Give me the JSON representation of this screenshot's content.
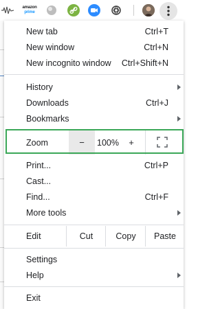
{
  "toolbar": {
    "amazon_line1": "amazon",
    "amazon_line2": "prime"
  },
  "menu": {
    "new_tab": {
      "label": "New tab",
      "shortcut": "Ctrl+T"
    },
    "new_window": {
      "label": "New window",
      "shortcut": "Ctrl+N"
    },
    "new_incognito": {
      "label": "New incognito window",
      "shortcut": "Ctrl+Shift+N"
    },
    "history": {
      "label": "History"
    },
    "downloads": {
      "label": "Downloads",
      "shortcut": "Ctrl+J"
    },
    "bookmarks": {
      "label": "Bookmarks"
    },
    "zoom": {
      "label": "Zoom",
      "minus": "−",
      "value": "100%",
      "plus": "+"
    },
    "print": {
      "label": "Print...",
      "shortcut": "Ctrl+P"
    },
    "cast": {
      "label": "Cast..."
    },
    "find": {
      "label": "Find...",
      "shortcut": "Ctrl+F"
    },
    "more_tools": {
      "label": "More tools"
    },
    "edit": {
      "label": "Edit",
      "cut": "Cut",
      "copy": "Copy",
      "paste": "Paste"
    },
    "settings": {
      "label": "Settings"
    },
    "help": {
      "label": "Help"
    },
    "exit": {
      "label": "Exit"
    }
  },
  "colors": {
    "highlight": "#3aa757",
    "divider": "#dadce0"
  }
}
